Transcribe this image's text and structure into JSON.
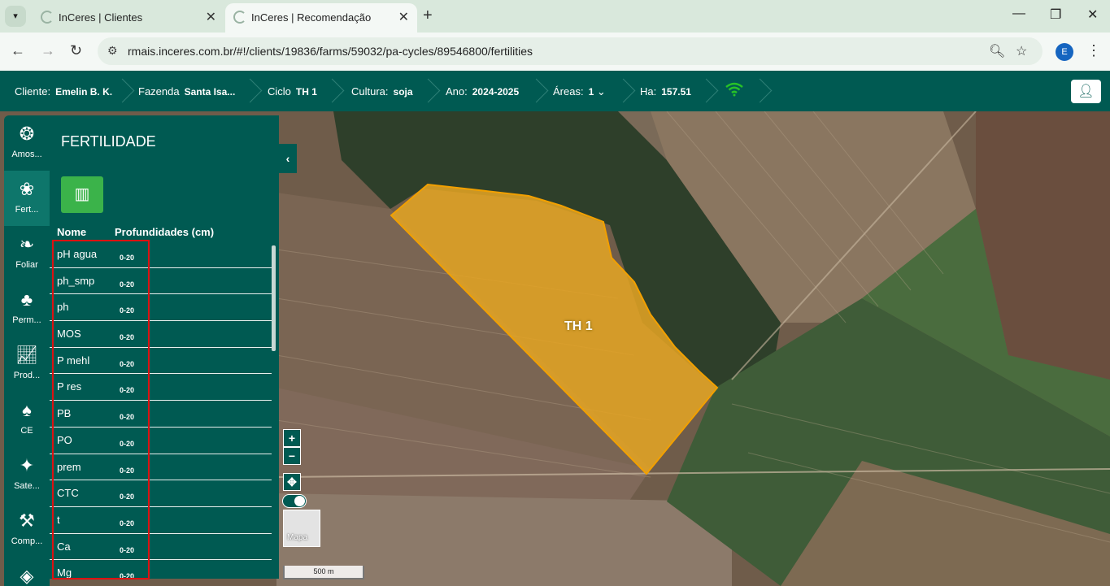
{
  "browser": {
    "tabs": [
      {
        "title": "InCeres | Clientes"
      },
      {
        "title": "InCeres | Recomendação"
      }
    ],
    "url": "rmais.inceres.com.br/#!/clients/19836/farms/59032/pa-cycles/89546800/fertilities",
    "profile_initial": "E"
  },
  "header": {
    "cliente_label": "Cliente:",
    "cliente_value": "Emelin B. K.",
    "fazenda_label": "Fazenda",
    "fazenda_value": "Santa Isa...",
    "ciclo_label": "Ciclo",
    "ciclo_value": "TH 1",
    "cultura_label": "Cultura:",
    "cultura_value": "soja",
    "ano_label": "Ano:",
    "ano_value": "2024-2025",
    "areas_label": "Áreas:",
    "areas_value": "1",
    "ha_label": "Ha:",
    "ha_value": "157.51"
  },
  "rail": [
    {
      "label": "Amos...",
      "icon": "soil-sample-icon"
    },
    {
      "label": "Fert...",
      "icon": "fertility-icon"
    },
    {
      "label": "Foliar",
      "icon": "leaf-icon"
    },
    {
      "label": "Perm...",
      "icon": "crops-icon"
    },
    {
      "label": "Prod...",
      "icon": "trend-chart-icon"
    },
    {
      "label": "CE",
      "icon": "plant-icon"
    },
    {
      "label": "Sate...",
      "icon": "satellite-icon"
    },
    {
      "label": "Comp...",
      "icon": "soil-compaction-icon"
    }
  ],
  "panel": {
    "title": "FERTILIDADE",
    "col_name": "Nome",
    "col_depth": "Profundidades (cm)",
    "rows": [
      {
        "name": "pH agua",
        "depth": "0-20"
      },
      {
        "name": "ph_smp",
        "depth": "0-20"
      },
      {
        "name": "ph",
        "depth": "0-20"
      },
      {
        "name": "MOS",
        "depth": "0-20"
      },
      {
        "name": "P mehl",
        "depth": "0-20"
      },
      {
        "name": "P res",
        "depth": "0-20"
      },
      {
        "name": "PB",
        "depth": "0-20"
      },
      {
        "name": "PO",
        "depth": "0-20"
      },
      {
        "name": "prem",
        "depth": "0-20"
      },
      {
        "name": "CTC",
        "depth": "0-20"
      },
      {
        "name": "t",
        "depth": "0-20"
      },
      {
        "name": "Ca",
        "depth": "0-20"
      },
      {
        "name": "Mg",
        "depth": "0-20"
      }
    ]
  },
  "map": {
    "area_label": "TH 1",
    "layer_label": "Mapa",
    "scale_label": "500 m",
    "zoom_in": "+",
    "zoom_out": "−",
    "highlight_color": "#d11111",
    "area_fill": "#e6a623"
  }
}
